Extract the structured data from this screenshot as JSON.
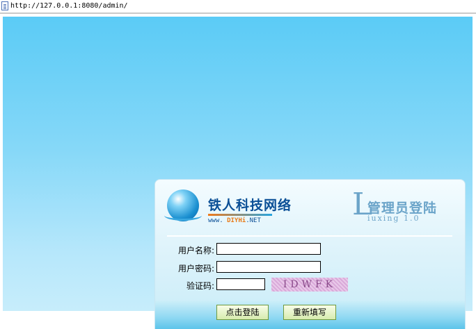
{
  "address_bar": {
    "url": "http://127.0.0.1:8080/admin/"
  },
  "brand": {
    "name": "铁人科技网络",
    "site_prefix": "www. ",
    "site_highlight": "DIYHi",
    "site_suffix": ".NET"
  },
  "admin_mark": {
    "big_letter": "L",
    "title": "管理员登陆",
    "version": "iuxing 1.0"
  },
  "form": {
    "username_label": "用户名称:",
    "username_value": "",
    "password_label": "用户密码:",
    "password_value": "",
    "captcha_label": "验证码:",
    "captcha_value": "",
    "captcha_text": "IDWFK"
  },
  "buttons": {
    "login": "点击登陆",
    "reset": "重新填写"
  },
  "icons": {
    "page": "page-icon",
    "logo": "globe-logo-icon"
  },
  "colors": {
    "background_top": "#5bcbf6",
    "brand": "#0a4f96",
    "admin_mark": "#6ba4c9",
    "button_border": "#6f9a3c"
  }
}
